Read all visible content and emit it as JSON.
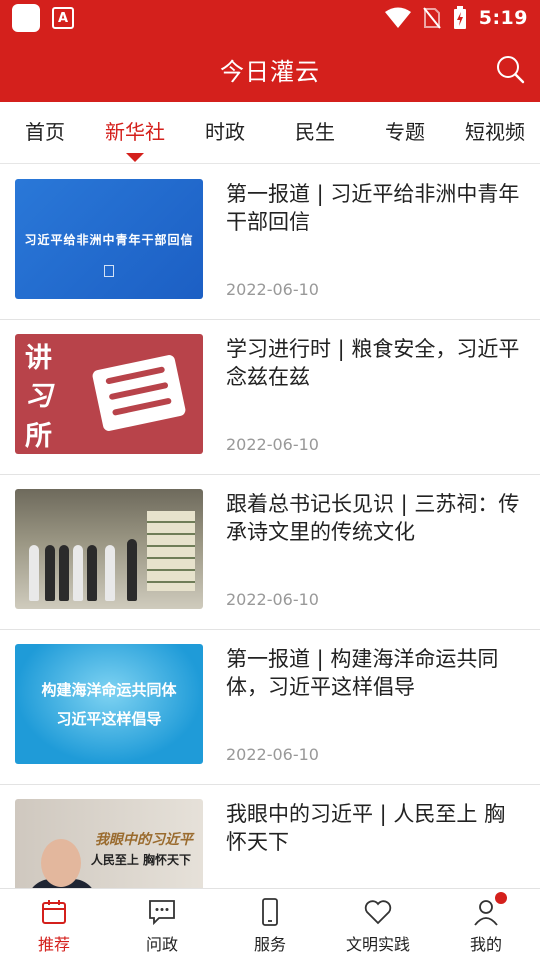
{
  "status_bar": {
    "time": "5:19",
    "icons": [
      "app-icon",
      "font-icon",
      "wifi-icon",
      "no-sim-icon",
      "battery-charging-icon"
    ]
  },
  "header": {
    "title": "今日灌云",
    "search_icon": "search-icon"
  },
  "tabs": [
    {
      "label": "首页",
      "active": false
    },
    {
      "label": "新华社",
      "active": true
    },
    {
      "label": "时政",
      "active": false
    },
    {
      "label": "民生",
      "active": false
    },
    {
      "label": "专题",
      "active": false
    },
    {
      "label": "短视频",
      "active": false
    }
  ],
  "news": [
    {
      "title": "第一报道 | 习近平给非洲中青年干部回信",
      "date": "2022-06-10",
      "thumb_text": "习近平给非洲中青年干部回信"
    },
    {
      "title": "学习进行时 | 粮食安全，习近平念兹在兹",
      "date": "2022-06-10",
      "thumb_chars": [
        "讲",
        "习",
        "所"
      ]
    },
    {
      "title": "跟着总书记长见识 | 三苏祠：传承诗文里的传统文化",
      "date": "2022-06-10"
    },
    {
      "title": "第一报道 | 构建海洋命运共同体，习近平这样倡导",
      "date": "2022-06-10",
      "thumb_lines": [
        "构建海洋命运共同体",
        "习近平这样倡导"
      ]
    },
    {
      "title": "我眼中的习近平 | 人民至上 胸怀天下",
      "date": "",
      "thumb_lines": [
        "我眼中的习近平",
        "人民至上 胸怀天下"
      ]
    }
  ],
  "bottom_nav": [
    {
      "label": "推荐",
      "icon": "calendar-icon",
      "active": true
    },
    {
      "label": "问政",
      "icon": "chat-icon",
      "active": false
    },
    {
      "label": "服务",
      "icon": "phone-icon",
      "active": false
    },
    {
      "label": "文明实践",
      "icon": "heart-icon",
      "active": false
    },
    {
      "label": "我的",
      "icon": "user-icon",
      "active": false,
      "badge": true
    }
  ],
  "colors": {
    "brand": "#d4201c",
    "text": "#222222",
    "date": "#999999"
  }
}
